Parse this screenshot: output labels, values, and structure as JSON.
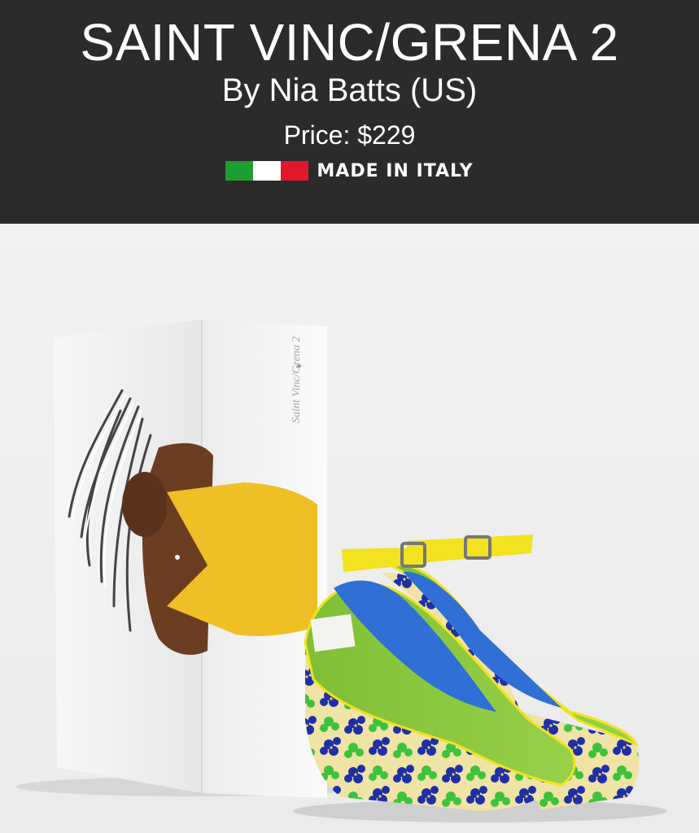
{
  "header": {
    "title": "SAINT VINC/GRENA 2",
    "designer": "By Nia Batts (US)",
    "price": "Price: $229",
    "made_in": "MADE IN ITALY",
    "flag_colors": [
      "#1e9e2f",
      "#ffffff",
      "#e3172b"
    ]
  },
  "product": {
    "box_label": "Saint Vinc/Grena 2",
    "colors": {
      "upper": "#8cc63f",
      "lining": "#2f6fd6",
      "strap": "#f2e21f",
      "wedge_floral_blue": "#1f2fa8",
      "wedge_floral_green": "#3ec23b",
      "wedge_base": "#efe3a6"
    }
  }
}
